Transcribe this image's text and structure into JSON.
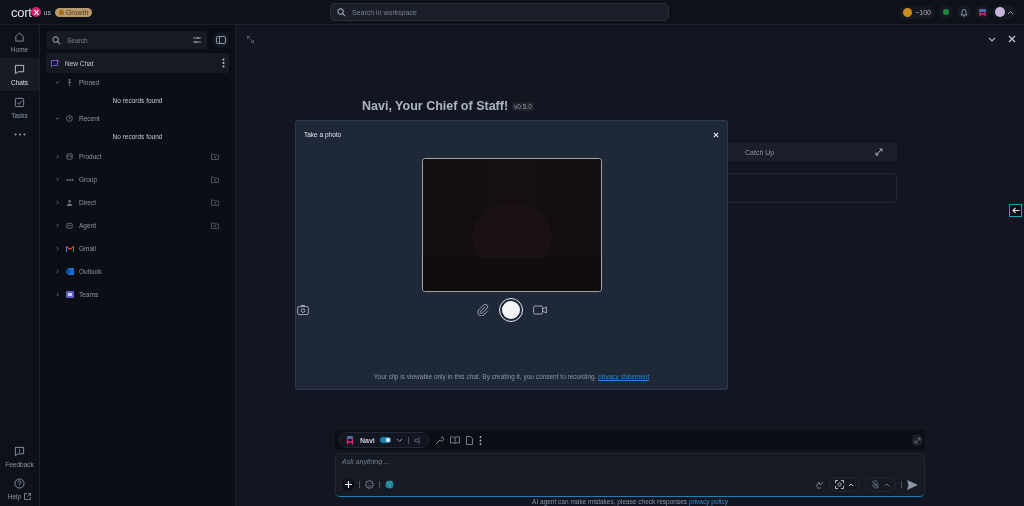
{
  "topbar": {
    "logo": {
      "text": "cort",
      "mark": "X",
      "region": "us"
    },
    "plan_badge": "Growth",
    "search": {
      "placeholder": "Search in workspace"
    },
    "credits": "~100"
  },
  "nav": {
    "items": [
      {
        "label": "Home",
        "selected": false
      },
      {
        "label": "Chats",
        "selected": true
      },
      {
        "label": "Tasks",
        "selected": false
      }
    ],
    "bottom": [
      {
        "label": "Feedback",
        "external": false
      },
      {
        "label": "Help",
        "external": true
      }
    ]
  },
  "sidebar": {
    "search": {
      "placeholder": "Search"
    },
    "new_chat": "New Chat",
    "sections": [
      {
        "label": "Pinned",
        "expanded": true,
        "can_add": false,
        "empty_text": "No records found"
      },
      {
        "label": "Recent",
        "expanded": true,
        "can_add": false,
        "empty_text": "No records found"
      },
      {
        "label": "Product",
        "expanded": false,
        "can_add": true
      },
      {
        "label": "Group",
        "expanded": false,
        "can_add": true
      },
      {
        "label": "Direct",
        "expanded": false,
        "can_add": true
      },
      {
        "label": "Agent",
        "expanded": false,
        "can_add": true
      },
      {
        "label": "Gmail",
        "expanded": false,
        "can_add": false
      },
      {
        "label": "Outlook",
        "expanded": false,
        "can_add": false
      },
      {
        "label": "Teams",
        "expanded": false,
        "can_add": false
      }
    ]
  },
  "main": {
    "title": "Navi, Your Chief of Staff!",
    "version": "v0.5.0",
    "tab": "Catch Up",
    "composer": {
      "agent": "Navi",
      "agent_on": true,
      "placeholder": "Ask anything ..."
    },
    "disclaimer": "AI agent can make mistakes, please check responses",
    "disclaimer_link": "privacy policy"
  },
  "modal": {
    "title": "Take a photo",
    "notice": "Your clip is viewable only in this chat. By creating it, you consent to recording.",
    "notice_link": "privacy statement"
  }
}
